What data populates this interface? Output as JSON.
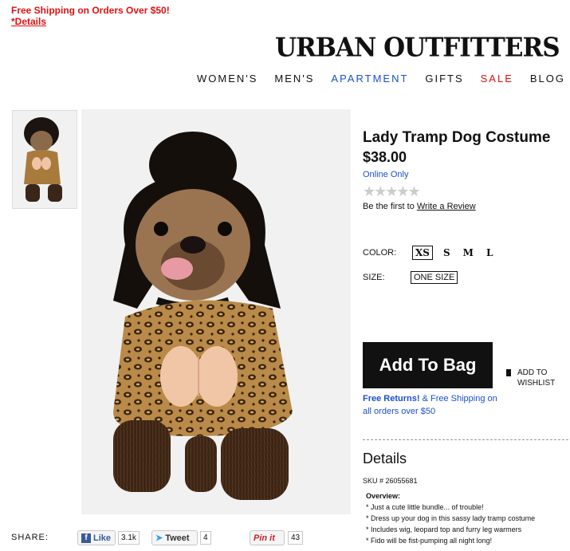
{
  "promo": {
    "text": "Free Shipping on Orders Over $50!",
    "link": "*Details"
  },
  "brand": {
    "logo": "URBAN OUTFITTERS"
  },
  "nav": [
    "WOMEN'S",
    "MEN'S",
    "APARTMENT",
    "GIFTS",
    "SALE",
    "BLOG"
  ],
  "product": {
    "title": "Lady Tramp Dog Costume",
    "price": "$38.00",
    "availability": "Online Only",
    "review_prefix": "Be the first to",
    "review_link": "Write a Review",
    "rating_stars": 0,
    "color_label": "COLOR:",
    "colors": [
      "XS",
      "S",
      "M",
      "L"
    ],
    "size_label": "SIZE:",
    "size_value": "ONE SIZE",
    "add_to_bag": "Add To Bag",
    "wishlist": "ADD TO WISHLIST",
    "returns_bold": "Free Returns!",
    "returns_text": "& Free Shipping on all orders over $50",
    "details_heading": "Details",
    "sku": "SKU # 26055681",
    "overview_heading": "Overview:",
    "overview": [
      "* Just a cute little bundle... of trouble!",
      "* Dress up your dog in this sassy lady tramp costume",
      "* Includes wig, leopard top and furry leg warmers",
      "* Fido will be fist-pumping all night long!"
    ]
  },
  "share": {
    "label": "SHARE:",
    "like_label": "Like",
    "like_count": "3.1k",
    "tweet_label": "Tweet",
    "tweet_count": "4",
    "pin_label": "Pin it",
    "pin_count": "43"
  },
  "colors": {
    "accent_blue": "#1a4fcf",
    "sale_red": "#d11111",
    "button_black": "#111111"
  }
}
